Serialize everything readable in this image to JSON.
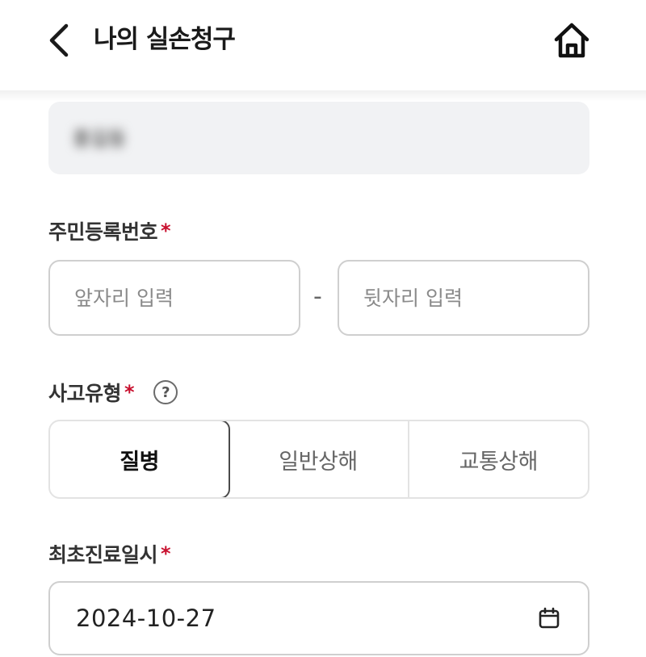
{
  "header": {
    "title": "나의 실손청구",
    "back_icon": "chevron-left-icon",
    "home_icon": "home-icon"
  },
  "name_field": {
    "value_blurred": "홍길동"
  },
  "resident_number": {
    "label": "주민등록번호",
    "required_mark": "*",
    "front_placeholder": "앞자리 입력",
    "separator": "-",
    "back_placeholder": "뒷자리 입력"
  },
  "accident_type": {
    "label": "사고유형",
    "required_mark": "*",
    "help_icon": "question-circle-icon",
    "help_glyph": "?",
    "options": [
      "질병",
      "일반상해",
      "교통상해"
    ],
    "selected": "질병"
  },
  "first_treatment_date": {
    "label": "최초진료일시",
    "required_mark": "*",
    "value": "2024-10-27",
    "calendar_icon": "calendar-icon"
  },
  "colors": {
    "required": "#c8102e",
    "input_bg_disabled": "#f1f2f4",
    "border": "#cfcfcf"
  }
}
